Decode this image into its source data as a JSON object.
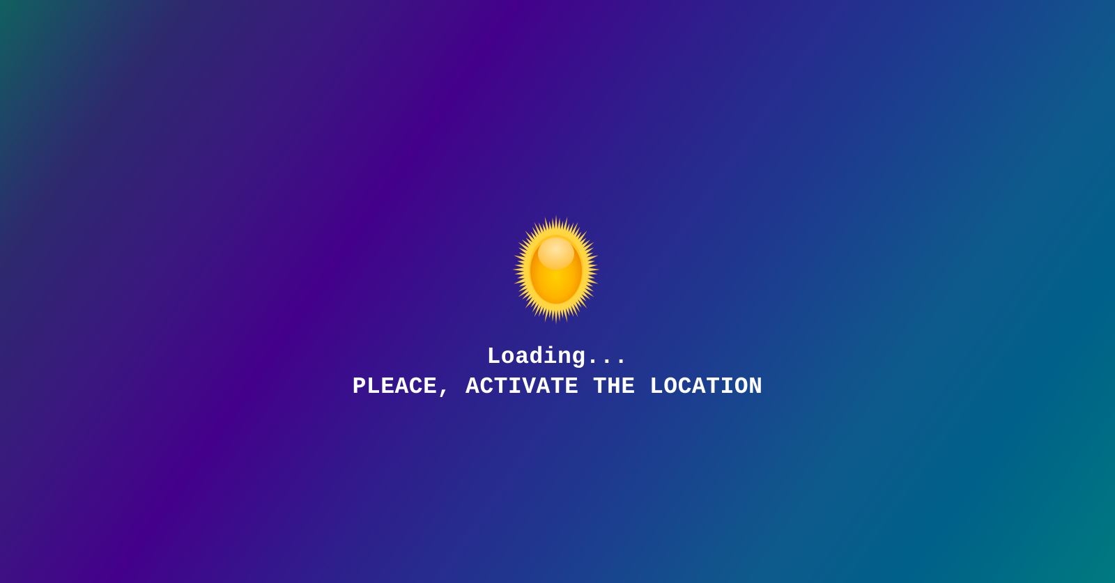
{
  "loading_screen": {
    "loading_text": "Loading...",
    "message": "PLEACE, ACTIVATE THE LOCATION",
    "icon": "sun-icon"
  },
  "colors": {
    "background_purple": "#44008b",
    "background_teal": "#007a80",
    "text": "#ffffff",
    "sun_core": "#ffb300",
    "sun_rays": "#ffd23a"
  }
}
